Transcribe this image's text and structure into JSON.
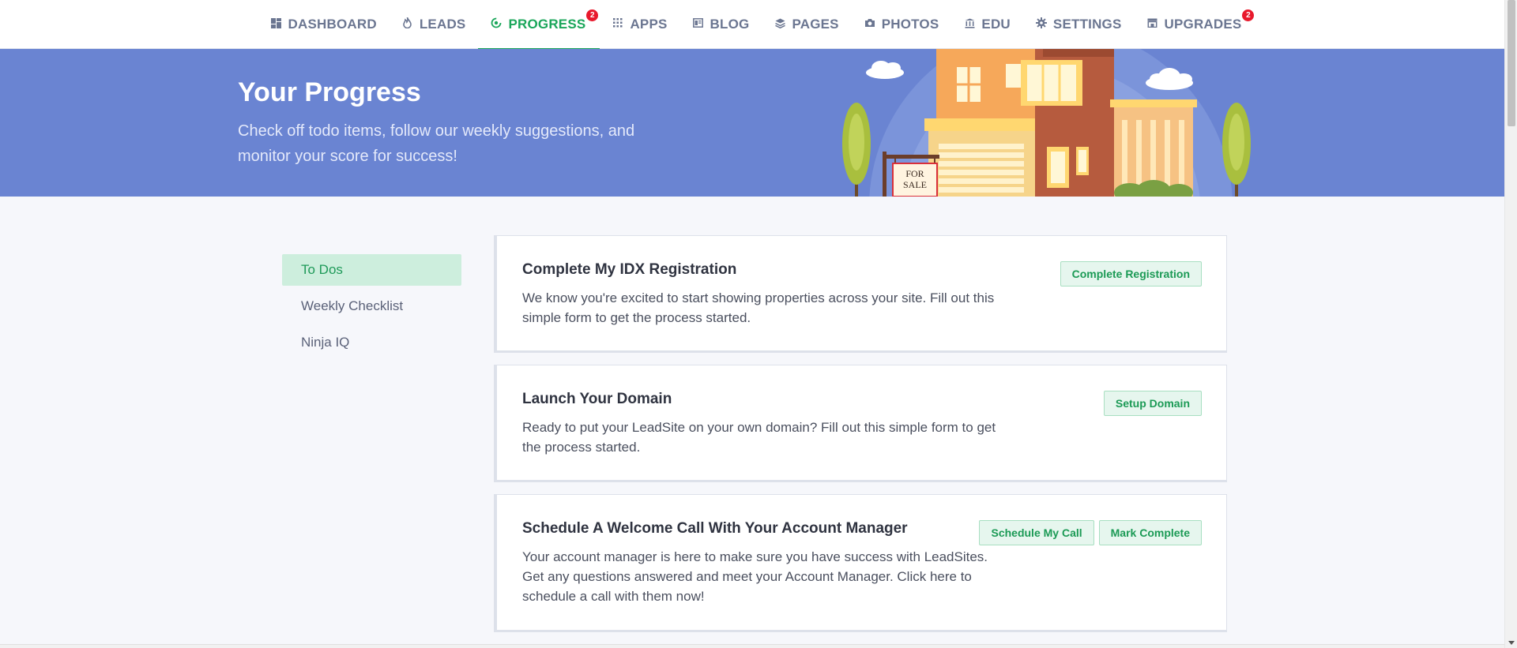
{
  "nav": {
    "items": [
      {
        "label": "DASHBOARD",
        "icon": "dashboard-icon"
      },
      {
        "label": "LEADS",
        "icon": "flame-icon"
      },
      {
        "label": "PROGRESS",
        "icon": "progress-icon",
        "badge": "2",
        "active": true
      },
      {
        "label": "APPS",
        "icon": "grid-icon"
      },
      {
        "label": "BLOG",
        "icon": "blog-icon"
      },
      {
        "label": "PAGES",
        "icon": "layers-icon"
      },
      {
        "label": "PHOTOS",
        "icon": "camera-icon"
      },
      {
        "label": "EDU",
        "icon": "building-icon"
      },
      {
        "label": "SETTINGS",
        "icon": "gear-icon"
      },
      {
        "label": "UPGRADES",
        "icon": "store-icon",
        "badge": "2"
      }
    ],
    "active_color": "#1aa65a",
    "badge_color": "#e8192c"
  },
  "banner": {
    "title": "Your Progress",
    "subtitle": "Check off todo items, follow our weekly suggestions, and monitor your score for success!",
    "sign_line1": "FOR",
    "sign_line2": "SALE",
    "background_color": "#6a84d2"
  },
  "sidebar": {
    "items": [
      {
        "label": "To Dos",
        "active": true
      },
      {
        "label": "Weekly Checklist"
      },
      {
        "label": "Ninja IQ"
      }
    ]
  },
  "cards": [
    {
      "title": "Complete My IDX Registration",
      "description": "We know you're excited to start showing properties across your site. Fill out this simple form to get the process started.",
      "buttons": [
        "Complete Registration"
      ]
    },
    {
      "title": "Launch Your Domain",
      "description": "Ready to put your LeadSite on your own domain? Fill out this simple form to get the process started.",
      "buttons": [
        "Setup Domain"
      ]
    },
    {
      "title": "Schedule A Welcome Call With Your Account Manager",
      "description": "Your account manager is here to make sure you have success with LeadSites. Get any questions answered and meet your Account Manager. Click here to schedule a call with them now!",
      "buttons": [
        "Schedule My Call",
        "Mark Complete"
      ]
    }
  ]
}
